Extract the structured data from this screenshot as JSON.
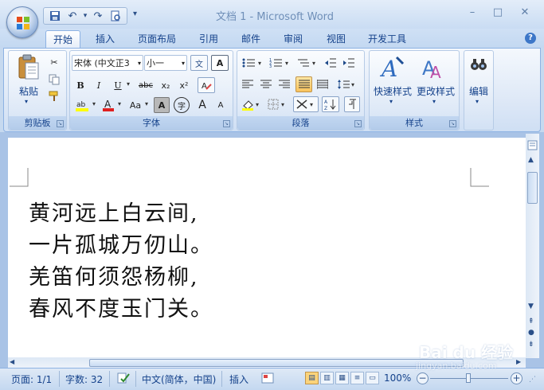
{
  "window": {
    "title": "文档 1 - Microsoft Word",
    "controls": {
      "minimize": "–",
      "maximize": "□",
      "close": "✕"
    }
  },
  "quick_access": {
    "save_icon": "save-icon",
    "undo_icon": "undo-icon",
    "redo_icon": "redo-icon",
    "print_preview_icon": "print-preview-icon",
    "customize_icon": "customize-qat-icon"
  },
  "tabs": [
    {
      "label": "开始",
      "active": true
    },
    {
      "label": "插入"
    },
    {
      "label": "页面布局"
    },
    {
      "label": "引用"
    },
    {
      "label": "邮件"
    },
    {
      "label": "审阅"
    },
    {
      "label": "视图"
    },
    {
      "label": "开发工具"
    }
  ],
  "ribbon": {
    "clipboard": {
      "group_label": "剪贴板",
      "paste_label": "粘贴",
      "cut_icon": "scissors-icon",
      "copy_icon": "copy-icon",
      "format_painter_icon": "format-painter-icon"
    },
    "font": {
      "group_label": "字体",
      "font_name": "宋体 (中文正3",
      "font_size": "小一",
      "bold": "B",
      "italic": "I",
      "underline": "U",
      "strikethrough": "abc",
      "subscript": "x₂",
      "superscript": "x²",
      "grow": "A",
      "shrink": "A",
      "change_case": "Aa",
      "char_shading": "A",
      "enclose": "字",
      "phonetic": "文",
      "char_border": "A",
      "clear": "A"
    },
    "paragraph": {
      "group_label": "段落"
    },
    "styles": {
      "group_label": "样式",
      "quick_styles_label": "快速样式",
      "change_styles_label": "更改样式"
    },
    "editing": {
      "label": "编辑"
    }
  },
  "document": {
    "lines": [
      "黄河远上白云间,",
      "一片孤城万仞山。",
      "羌笛何须怨杨柳,",
      "春风不度玉门关。"
    ]
  },
  "status_bar": {
    "page": "页面: 1/1",
    "word_count": "字数: 32",
    "language": "中文(简体，中国)",
    "mode": "插入",
    "zoom": "100%",
    "zoom_minus": "−",
    "zoom_plus": "+"
  },
  "watermark": {
    "brand": "Bai du 经验",
    "url": "jingyan.baidu.com"
  },
  "colors": {
    "ribbon_bg": "#dfe9f7",
    "tab_text": "#15428b",
    "highlight_yellow": "#ffff00",
    "font_color_red": "#e02020",
    "pressed_orange": "#f9c35d"
  }
}
